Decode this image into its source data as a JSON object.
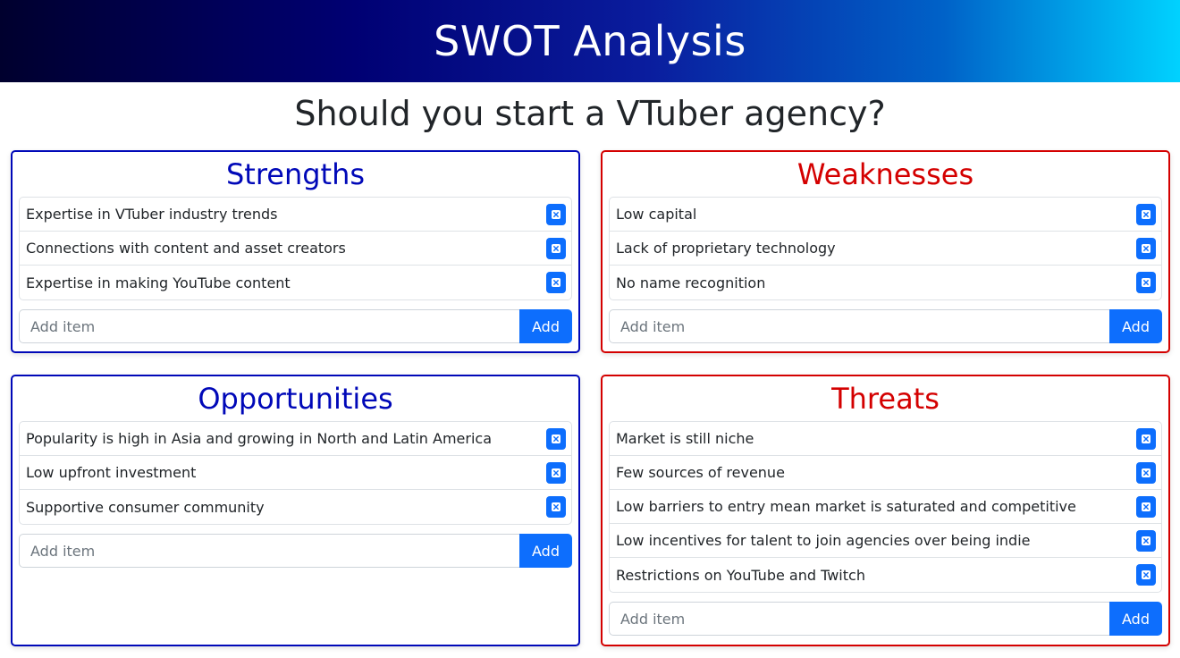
{
  "header": {
    "title": "SWOT Analysis"
  },
  "question": "Should you start a VTuber agency?",
  "colors": {
    "blue": "#0008b8",
    "red": "#d40000",
    "button": "#0d6efd"
  },
  "panels": {
    "strengths": {
      "title": "Strengths",
      "items": [
        "Expertise in VTuber industry trends",
        "Connections with content and asset creators",
        "Expertise in making YouTube content"
      ],
      "placeholder": "Add item",
      "add_label": "Add",
      "delete_icon": "close-square-icon"
    },
    "weaknesses": {
      "title": "Weaknesses",
      "items": [
        "Low capital",
        "Lack of proprietary technology",
        "No name recognition"
      ],
      "placeholder": "Add item",
      "add_label": "Add",
      "delete_icon": "close-square-icon"
    },
    "opportunities": {
      "title": "Opportunities",
      "items": [
        "Popularity is high in Asia and growing in North and Latin America",
        "Low upfront investment",
        "Supportive consumer community"
      ],
      "placeholder": "Add item",
      "add_label": "Add",
      "delete_icon": "close-square-icon"
    },
    "threats": {
      "title": "Threats",
      "items": [
        "Market is still niche",
        "Few sources of revenue",
        "Low barriers to entry mean market is saturated and competitive",
        "Low incentives for talent to join agencies over being indie",
        "Restrictions on YouTube and Twitch"
      ],
      "placeholder": "Add item",
      "add_label": "Add",
      "delete_icon": "close-square-icon"
    }
  }
}
